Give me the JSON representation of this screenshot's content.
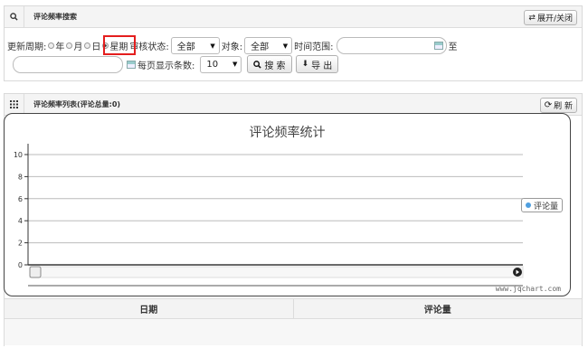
{
  "search": {
    "title": "评论频率搜索",
    "toggle_label": "展开/关闭",
    "period_label": "更新周期:",
    "periods": [
      "年",
      "月",
      "日",
      "星期"
    ],
    "selected_period": "星期",
    "status_label": "审核状态:",
    "status_value": "全部",
    "target_label": "对象:",
    "target_value": "全部",
    "range_label": "时间范围:",
    "range_to": "至",
    "start_value": "",
    "end_value": "",
    "page_size_label": "每页显示条数:",
    "page_size_value": "10",
    "search_label": "搜 索",
    "export_label": "导 出"
  },
  "list": {
    "title": "评论频率列表(评论总量:0)",
    "refresh_label": "刷 新"
  },
  "chart_data": {
    "type": "line",
    "title": "评论频率统计",
    "ylim": [
      0,
      10
    ],
    "yticks": [
      "0",
      "2",
      "4",
      "6",
      "8",
      "10"
    ],
    "series": [
      {
        "name": "评论量",
        "values": []
      }
    ],
    "grid": true,
    "legend": "right",
    "watermark": "www.jqchart.com",
    "colors": {
      "series": "#4f9fe0"
    }
  },
  "table": {
    "columns": [
      "日期",
      "评论量"
    ],
    "rows": []
  }
}
